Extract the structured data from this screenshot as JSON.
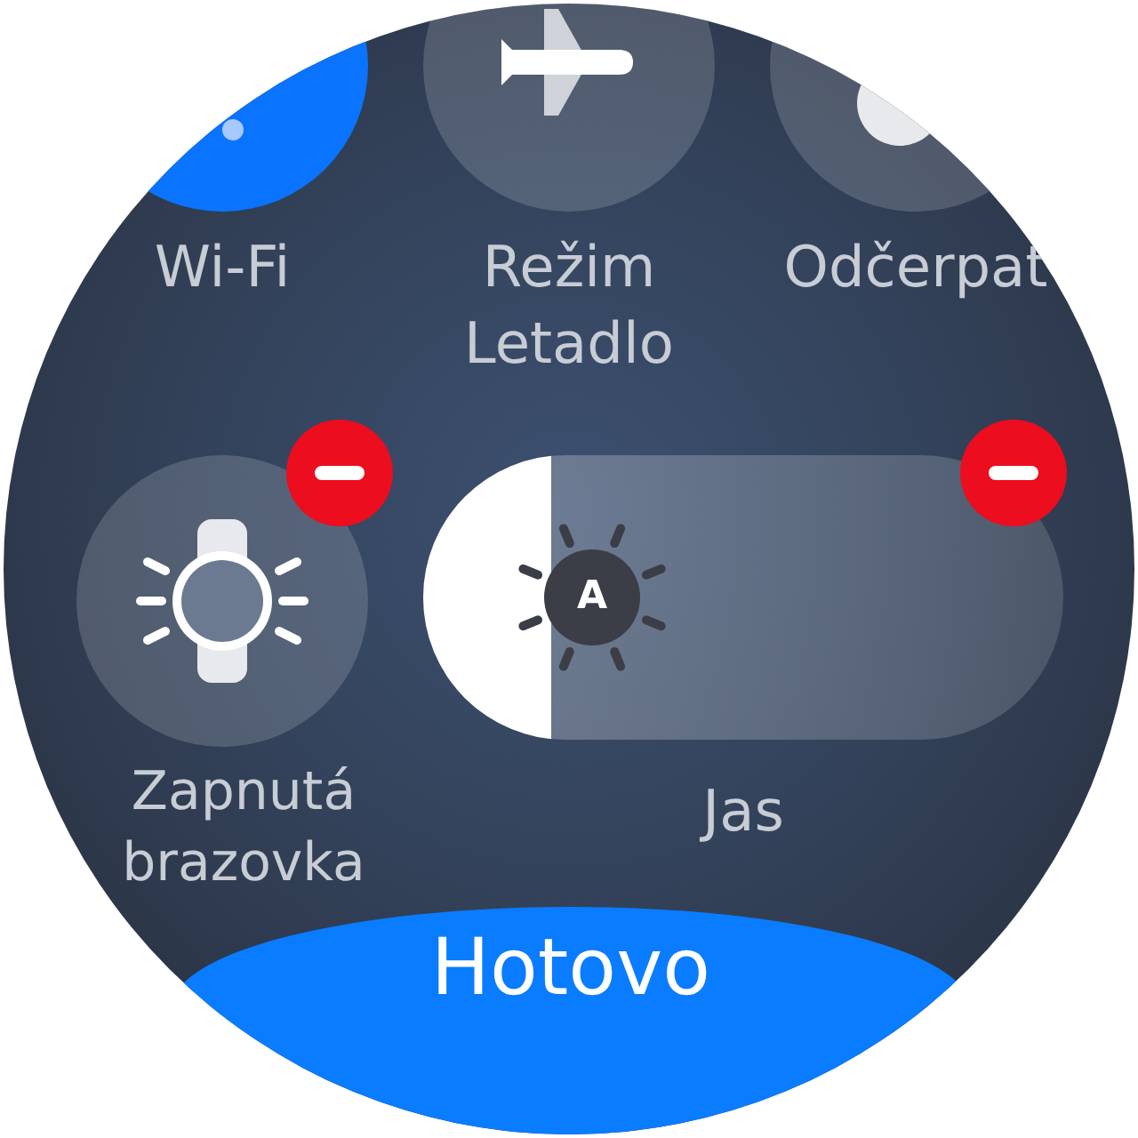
{
  "tiles": [
    {
      "label": "Wi-Fi",
      "kind": "wifi",
      "on": true
    },
    {
      "label": "Režim Letadlo",
      "kind": "airplane",
      "on": false
    },
    {
      "label": "Odčerpat",
      "kind": "water",
      "on": false
    }
  ],
  "edit_row": {
    "tile": {
      "label": "Zapnutá brazovka",
      "kind": "watch",
      "on": false,
      "removable": true
    },
    "brightness": {
      "label": "Jas",
      "level": 0.2,
      "auto_label": "A",
      "removable": true
    }
  },
  "done_button": "Hotovo"
}
